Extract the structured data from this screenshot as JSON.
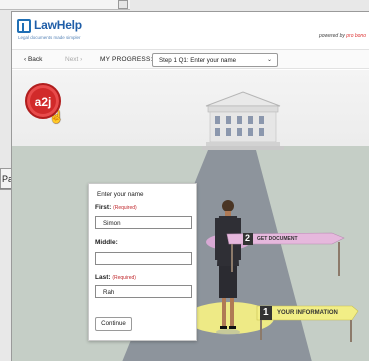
{
  "background_window": {
    "tab_text": "Pa"
  },
  "header": {
    "logo_text": "LawHelp",
    "logo_subtext": "Legal documents made simpler",
    "powered_by": "powered by",
    "powered_by_brand": "pro bono"
  },
  "nav": {
    "back_label": "‹  Back",
    "next_label": "Next  ›",
    "progress_label": "MY PROGRESS:",
    "progress_value": "Step 1 Q1: Enter your name",
    "chevron": "⌄"
  },
  "badge": {
    "text": "a2j"
  },
  "form": {
    "title": "Enter your name",
    "first_label": "First:",
    "first_required": "(Required)",
    "first_value": "Simon",
    "middle_label": "Middle:",
    "middle_value": "",
    "last_label": "Last:",
    "last_required": "(Required)",
    "last_value": "Rah",
    "continue_label": "Continue"
  },
  "steps": [
    {
      "number": "2",
      "label": "GET DOCUMENT",
      "color": "#e6b8dd"
    },
    {
      "number": "1",
      "label": "YOUR INFORMATION",
      "color": "#f2ee86"
    }
  ],
  "colors": {
    "brand_blue": "#1f5ea8",
    "badge_red": "#d12a2a",
    "required_red": "#c0282d",
    "ground": "#c5cec6",
    "path": "#8d949c"
  },
  "icons": [
    "lawhelp-logo-icon",
    "hand-cursor-icon",
    "courthouse-icon",
    "guide-woman-icon",
    "chevron-down-icon"
  ]
}
